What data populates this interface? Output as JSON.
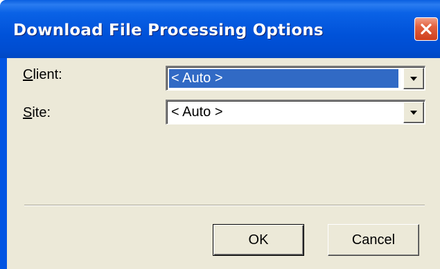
{
  "window": {
    "title": "Download File Processing Options",
    "close_icon": "close-icon"
  },
  "form": {
    "client": {
      "label_access_key": "C",
      "label_rest": "lient:",
      "value": "< Auto >",
      "selected": true
    },
    "site": {
      "label_access_key": "S",
      "label_rest": "ite:",
      "value": "< Auto >",
      "selected": false
    }
  },
  "buttons": {
    "ok_label": "OK",
    "cancel_label": "Cancel"
  },
  "colors": {
    "title_bar": "#0054e3",
    "close_button": "#e2603d",
    "dialog_face": "#ece9d8",
    "selection_highlight": "#316ac5"
  }
}
